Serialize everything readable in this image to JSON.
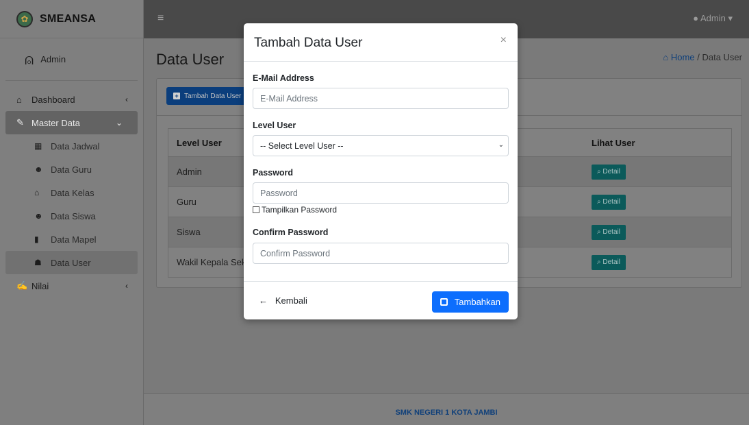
{
  "brand": {
    "name": "SMEANSA"
  },
  "user_panel": {
    "name": "Admin"
  },
  "sidebar": {
    "items": [
      {
        "label": "Dashboard",
        "icon": "home-icon"
      },
      {
        "label": "Master Data",
        "icon": "edit-icon"
      },
      {
        "label": "Nilai",
        "icon": "signature-icon"
      }
    ],
    "sub_items": [
      {
        "label": "Data Jadwal",
        "icon": "calendar-icon"
      },
      {
        "label": "Data Guru",
        "icon": "users-icon"
      },
      {
        "label": "Data Kelas",
        "icon": "home-icon"
      },
      {
        "label": "Data Siswa",
        "icon": "users-icon"
      },
      {
        "label": "Data Mapel",
        "icon": "book-icon"
      },
      {
        "label": "Data User",
        "icon": "user-plus-icon"
      }
    ]
  },
  "topbar": {
    "admin_label": "Admin"
  },
  "page": {
    "title": "Data User",
    "breadcrumb_home": "Home",
    "breadcrumb_sep": "/",
    "breadcrumb_current": "Data User"
  },
  "card": {
    "add_button": "Tambah Data User"
  },
  "table": {
    "headers": {
      "level": "Level User",
      "lihat": "Lihat User"
    },
    "rows": [
      {
        "level": "Admin",
        "action": "Detail"
      },
      {
        "level": "Guru",
        "action": "Detail"
      },
      {
        "level": "Siswa",
        "action": "Detail"
      },
      {
        "level": "Wakil Kepala Sekolah",
        "action": "Detail"
      }
    ]
  },
  "footer": {
    "text": "SMK NEGERI 1 KOTA JAMBI"
  },
  "modal": {
    "title": "Tambah Data User",
    "close": "×",
    "email_label": "E-Mail Address",
    "email_placeholder": "E-Mail Address",
    "level_label": "Level User",
    "level_selected": "-- Select Level User --",
    "password_label": "Password",
    "password_placeholder": "Password",
    "show_password": "Tampilkan Password",
    "confirm_label": "Confirm Password",
    "confirm_placeholder": "Confirm Password",
    "back_button": "Kembali",
    "submit_button": "Tambahkan"
  },
  "colors": {
    "primary": "#0d6efd",
    "backdrop": "#7f7f7f",
    "detail": "#0b5a5a"
  }
}
